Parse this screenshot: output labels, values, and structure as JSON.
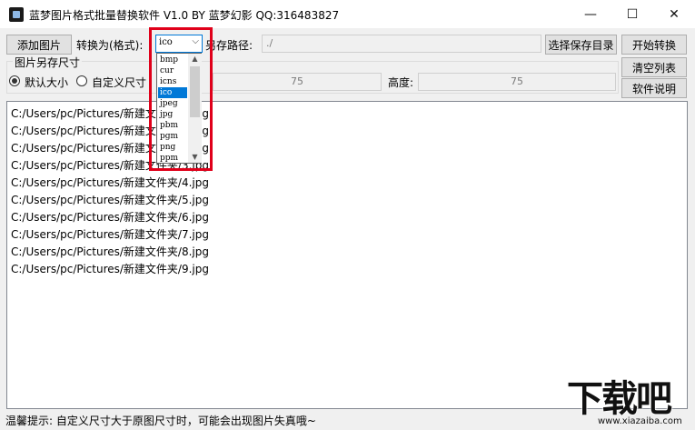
{
  "window": {
    "title": "蓝梦图片格式批量替换软件 V1.0 BY 蓝梦幻影 QQ:316483827",
    "minimize": "—",
    "maximize": "☐",
    "close": "✕"
  },
  "toolbar": {
    "add_images": "添加图片",
    "convert_to_label": "转换为(格式):",
    "format_selected": "ico",
    "save_path_label": "另存路径:",
    "save_path_value": "./",
    "choose_dir": "选择保存目录",
    "start_convert": "开始转换",
    "clear_list": "清空列表",
    "help": "软件说明"
  },
  "size_group": {
    "title": "图片另存尺寸",
    "default_size": "默认大小",
    "custom_size": "自定义尺寸",
    "width_value": "75",
    "height_label": "高度:",
    "height_value": "75"
  },
  "format_dropdown": {
    "options": [
      "bmp",
      "cur",
      "icns",
      "ico",
      "jpeg",
      "jpg",
      "pbm",
      "pgm",
      "png",
      "ppm"
    ],
    "selected": "ico"
  },
  "file_list": {
    "rows": [
      "C:/Users/pc/Pictures/新建文件夹/1.jpg",
      "C:/Users/pc/Pictures/新建文件夹/2.jpg",
      "C:/Users/pc/Pictures/新建文件夹/3.jpg",
      "C:/Users/pc/Pictures/新建文件夹/3.jpg",
      "C:/Users/pc/Pictures/新建文件夹/4.jpg",
      "C:/Users/pc/Pictures/新建文件夹/5.jpg",
      "C:/Users/pc/Pictures/新建文件夹/6.jpg",
      "C:/Users/pc/Pictures/新建文件夹/7.jpg",
      "C:/Users/pc/Pictures/新建文件夹/8.jpg",
      "C:/Users/pc/Pictures/新建文件夹/9.jpg"
    ]
  },
  "status": {
    "text": "温馨提示: 自定义尺寸大于原图尺寸时，可能会出现图片失真哦~"
  },
  "watermark": {
    "main": "下载吧",
    "url": "www.xiazaiba.com"
  },
  "colors": {
    "highlight": "#e0001a",
    "selection": "#0078d7"
  }
}
